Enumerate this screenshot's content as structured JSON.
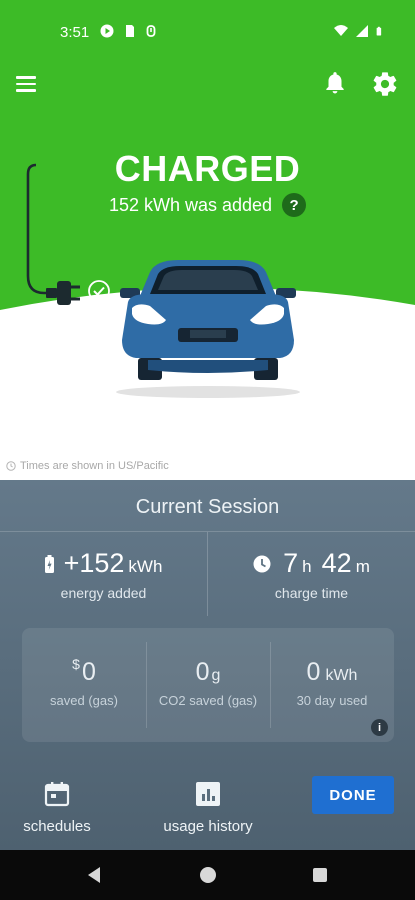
{
  "status_bar": {
    "time": "3:51"
  },
  "app_bar": {
    "menu_icon": "hamburger-menu-icon",
    "bell_icon": "bell-icon",
    "gear_icon": "gear-icon"
  },
  "hero": {
    "status_title": "CHARGED",
    "added_text": "152 kWh was added",
    "help_label": "?",
    "timezone_note": "Times are shown in US/Pacific",
    "colors": {
      "green": "#3dbb27",
      "car_blue": "#2f6ca6"
    }
  },
  "session": {
    "title": "Current Session",
    "energy": {
      "value": "+152",
      "unit": "kWh",
      "label": "energy added"
    },
    "charge_time": {
      "hours": "7",
      "hours_unit": "h",
      "minutes": "42",
      "minutes_unit": "m",
      "label": "charge time"
    },
    "savings": [
      {
        "prefix": "$",
        "value": "0",
        "suffix": "",
        "label": "saved (gas)"
      },
      {
        "prefix": "",
        "value": "0",
        "suffix": "g",
        "label": "CO2 saved (gas)"
      },
      {
        "prefix": "",
        "value": "0",
        "suffix": "kWh",
        "label": "30 day used"
      }
    ],
    "info_label": "i"
  },
  "actions": {
    "schedules_label": "schedules",
    "usage_history_label": "usage history",
    "done_label": "DONE",
    "done_color": "#1f6fd1"
  }
}
